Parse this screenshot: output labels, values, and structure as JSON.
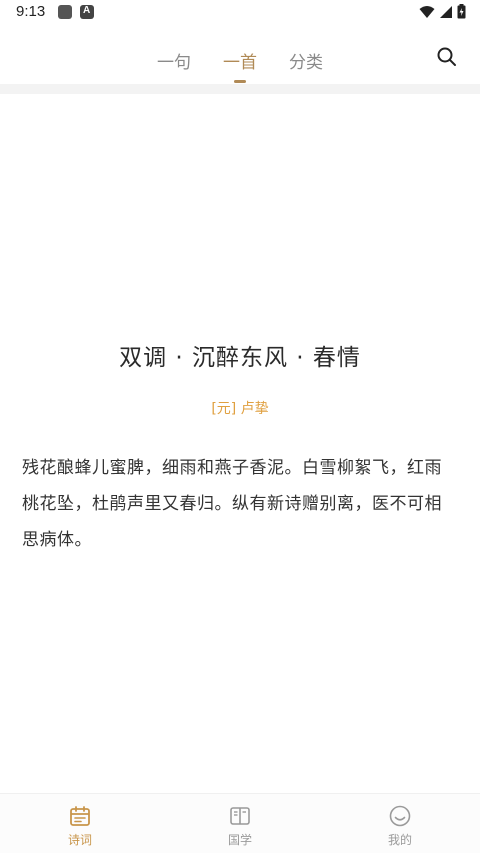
{
  "status_bar": {
    "time": "9:13"
  },
  "top_tabs": [
    {
      "label": "一句",
      "active": false
    },
    {
      "label": "一首",
      "active": true
    },
    {
      "label": "分类",
      "active": false
    }
  ],
  "poem": {
    "title": "双调 · 沉醉东风 · 春情",
    "author": "[元] 卢挚",
    "body": "残花酿蜂儿蜜脾，细雨和燕子香泥。白雪柳絮飞，红雨桃花坠，杜鹃声里又春归。纵有新诗赠别离，医不可相思病体。"
  },
  "bottom_nav": [
    {
      "label": "诗词",
      "icon": "calendar-icon",
      "active": true
    },
    {
      "label": "国学",
      "icon": "book-icon",
      "active": false
    },
    {
      "label": "我的",
      "icon": "smiley-icon",
      "active": false
    }
  ],
  "colors": {
    "accent": "#b08a56",
    "author": "#e0a040",
    "nav_active": "#c8954a"
  }
}
